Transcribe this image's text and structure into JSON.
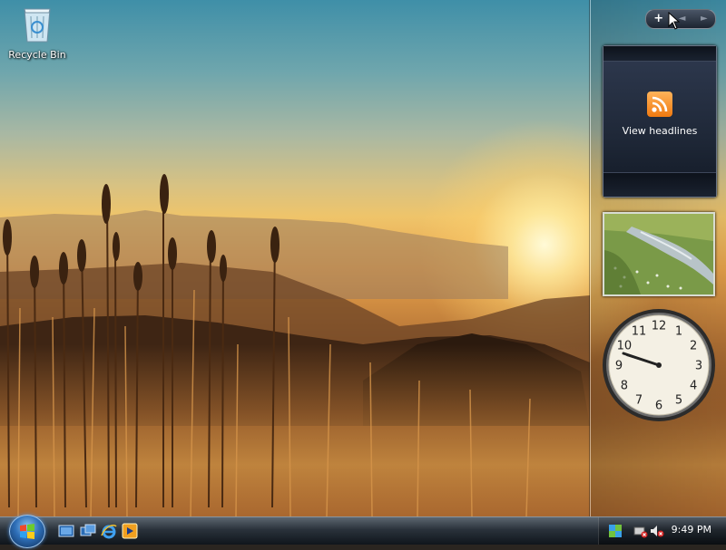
{
  "desktop": {
    "icons": [
      {
        "label": "Recycle Bin",
        "icon": "recycle-bin-icon"
      }
    ]
  },
  "sidebar": {
    "controls": {
      "add_symbol": "+",
      "prev_symbol": "◄",
      "next_symbol": "►"
    },
    "feed_gadget": {
      "label": "View headlines",
      "icon": "rss-feed-icon"
    },
    "slideshow_gadget": {
      "icon": "photo-slideshow"
    },
    "clock_gadget": {
      "numerals": [
        "12",
        "1",
        "2",
        "3",
        "4",
        "5",
        "6",
        "7",
        "8",
        "9",
        "10",
        "11"
      ],
      "time": "9:49"
    }
  },
  "taskbar": {
    "start_icon": "windows-orb-icon",
    "quick_launch": [
      "show-desktop-icon",
      "switch-windows-icon",
      "internet-explorer-icon",
      "media-player-icon"
    ],
    "tray_icons": [
      "network-icon",
      "safely-remove-icon",
      "volume-muted-icon"
    ],
    "clock": "9:49 PM"
  },
  "colors": {
    "taskbar": "#1c242c",
    "rss": "#f07a10",
    "start_orb": "#2e6fb8"
  }
}
